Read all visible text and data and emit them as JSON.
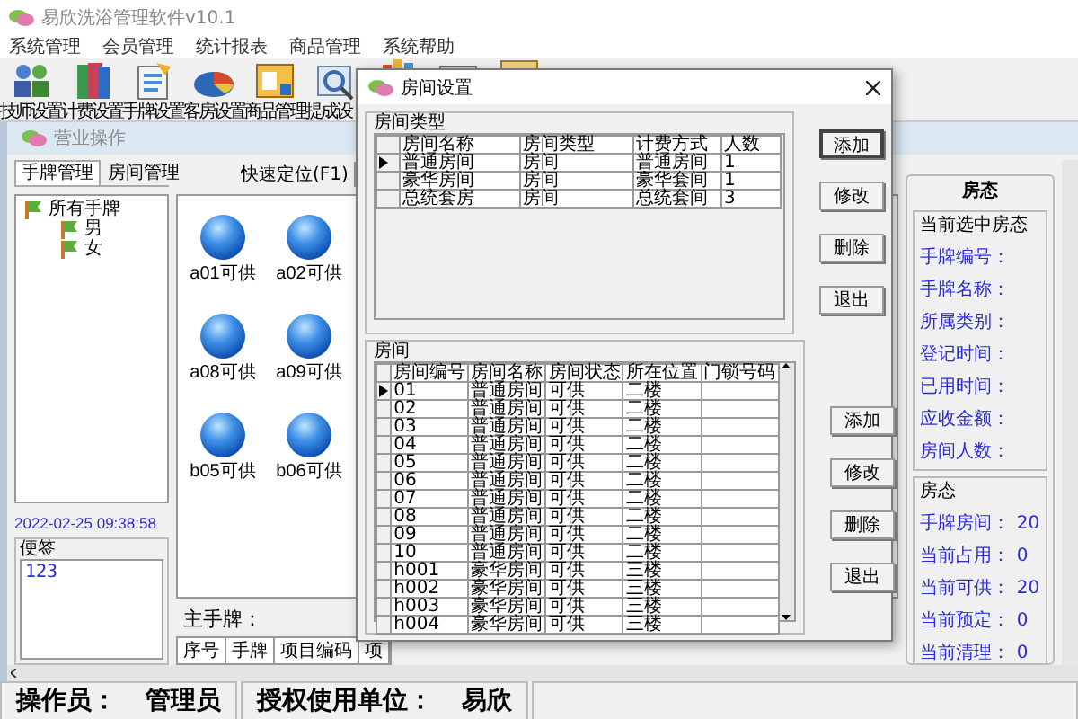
{
  "window": {
    "title": "易欣洗浴管理软件v10.1"
  },
  "menu": [
    "系统管理",
    "会员管理",
    "统计报表",
    "商品管理",
    "系统帮助"
  ],
  "toolbar": [
    {
      "label": "技师设置"
    },
    {
      "label": "计费设置"
    },
    {
      "label": "手牌设置"
    },
    {
      "label": "客房设置"
    },
    {
      "label": "商品管理"
    },
    {
      "label": "提成设"
    }
  ],
  "child": {
    "title": "营业操作",
    "tabs": [
      {
        "label": "手牌管理",
        "selected": true
      },
      {
        "label": "房间管理",
        "selected": false
      }
    ],
    "quick_locate": {
      "label": "快速定位(F1)"
    },
    "tree": {
      "label": "所有手牌",
      "expanded": true,
      "children": [
        {
          "label": "男"
        },
        {
          "label": "女"
        }
      ]
    },
    "datetime": "2022-02-25 09:38:58",
    "memo": {
      "title": "便签",
      "value": "123"
    },
    "tiles": [
      {
        "label": "a01可供"
      },
      {
        "label": "a02可供"
      },
      {
        "label": "a08可供"
      },
      {
        "label": "a09可供"
      },
      {
        "label": "b05可供"
      },
      {
        "label": "b06可供"
      }
    ],
    "main_tag": {
      "label": "主手牌：",
      "columns": [
        "序号",
        "手牌",
        "项目编码",
        "项"
      ]
    }
  },
  "room_status": {
    "title": "房态",
    "selected_group": {
      "title": "当前选中房态",
      "fields": [
        "手牌编号：",
        "手牌名称：",
        "所属类别：",
        "登记时间：",
        "已用时间：",
        "应收金额：",
        "房间人数："
      ]
    },
    "summary": {
      "title": "房态",
      "rows": [
        {
          "label": "手牌房间：",
          "value": "20"
        },
        {
          "label": "当前占用：",
          "value": "0"
        },
        {
          "label": "当前可供：",
          "value": "20"
        },
        {
          "label": "当前预定：",
          "value": "0"
        },
        {
          "label": "当前清理：",
          "value": "0"
        }
      ]
    }
  },
  "dialog": {
    "title": "房间设置",
    "room_types": {
      "title": "房间类型",
      "columns": [
        "房间名称",
        "房间类型",
        "计费方式",
        "人数"
      ],
      "rows": [
        {
          "cells": [
            "普通房间",
            "房间",
            "普通房间",
            "1"
          ],
          "selected": true
        },
        {
          "cells": [
            "豪华房间",
            "房间",
            "豪华套间",
            "1"
          ],
          "selected": false
        },
        {
          "cells": [
            "总统套房",
            "房间",
            "总统套间",
            "3"
          ],
          "selected": false
        }
      ]
    },
    "type_buttons": [
      {
        "label": "添加",
        "default": true
      },
      {
        "label": "修改",
        "default": false
      },
      {
        "label": "删除",
        "default": false
      },
      {
        "label": "退出",
        "default": false
      }
    ],
    "rooms": {
      "title": "房间",
      "columns": [
        "房间编号",
        "房间名称",
        "房间状态",
        "所在位置",
        "门锁号码"
      ],
      "rows": [
        {
          "cells": [
            "01",
            "普通房间",
            "可供",
            "二楼",
            ""
          ],
          "selected": true
        },
        {
          "cells": [
            "02",
            "普通房间",
            "可供",
            "二楼",
            ""
          ],
          "selected": false
        },
        {
          "cells": [
            "03",
            "普通房间",
            "可供",
            "二楼",
            ""
          ],
          "selected": false
        },
        {
          "cells": [
            "04",
            "普通房间",
            "可供",
            "二楼",
            ""
          ],
          "selected": false
        },
        {
          "cells": [
            "05",
            "普通房间",
            "可供",
            "二楼",
            ""
          ],
          "selected": false
        },
        {
          "cells": [
            "06",
            "普通房间",
            "可供",
            "二楼",
            ""
          ],
          "selected": false
        },
        {
          "cells": [
            "07",
            "普通房间",
            "可供",
            "二楼",
            ""
          ],
          "selected": false
        },
        {
          "cells": [
            "08",
            "普通房间",
            "可供",
            "二楼",
            ""
          ],
          "selected": false
        },
        {
          "cells": [
            "09",
            "普通房间",
            "可供",
            "二楼",
            ""
          ],
          "selected": false
        },
        {
          "cells": [
            "10",
            "普通房间",
            "可供",
            "二楼",
            ""
          ],
          "selected": false
        },
        {
          "cells": [
            "h001",
            "豪华房间",
            "可供",
            "三楼",
            ""
          ],
          "selected": false
        },
        {
          "cells": [
            "h002",
            "豪华房间",
            "可供",
            "三楼",
            ""
          ],
          "selected": false
        },
        {
          "cells": [
            "h003",
            "豪华房间",
            "可供",
            "三楼",
            ""
          ],
          "selected": false
        },
        {
          "cells": [
            "h004",
            "豪华房间",
            "可供",
            "三楼",
            ""
          ],
          "selected": false
        }
      ]
    },
    "room_buttons": [
      {
        "label": "添加",
        "default": false
      },
      {
        "label": "修改",
        "default": false
      },
      {
        "label": "删除",
        "default": false
      },
      {
        "label": "退出",
        "default": false
      }
    ]
  },
  "status_bar": [
    {
      "label": "操作员：",
      "value": "管理员"
    },
    {
      "label": "授权使用单位：",
      "value": "易欣"
    }
  ]
}
